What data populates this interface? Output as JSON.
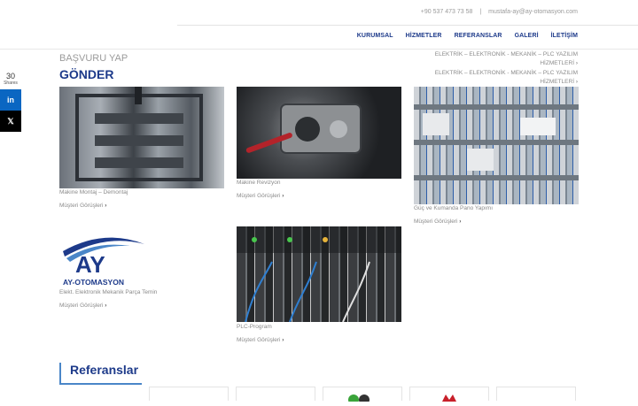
{
  "header": {
    "phone": "+90 537 473 73 58",
    "separator": "|",
    "email": "mustafa-ay@ay-otomasyon.com",
    "nav": [
      "KURUMSAL",
      "HİZMETLER",
      "REFERANSLAR",
      "GALERİ",
      "İLETİŞİM"
    ]
  },
  "share": {
    "count": "30",
    "label": "Shares",
    "linkedin_glyph": "in",
    "x_glyph": "𝕏"
  },
  "page": {
    "apply_text": "BAŞVURU YAP",
    "send_text": "GÖNDER"
  },
  "services": {
    "line1": "ELEKTRİK – ELEKTRONİK - MEKANİK – PLC YAZILIM",
    "line2": "HİZMETLERİ",
    "line3": "ELEKTRİK – ELEKTRONİK - MEKANİK – PLC YAZILIM",
    "line4": "HİZMETLERİ",
    "chevron": "›"
  },
  "gallery": {
    "more_label": "Müşteri Görüşleri",
    "chevron": "›",
    "items": [
      {
        "caption": "Makine Montaj – Demontaj",
        "icon": "machine-assembly-photo"
      },
      {
        "caption": "Makine Revizyon",
        "icon": "carburetor-repair-photo"
      },
      {
        "caption": "Güç ve Kumanda Pano Yapımı",
        "icon": "electrical-panel-photo"
      },
      {
        "caption": "Elekt. Elektronik Mekanik Parça Temin",
        "icon": "ay-otomasyon-logo"
      },
      {
        "caption": "PLC-Program",
        "icon": "plc-wiring-photo"
      }
    ]
  },
  "logo": {
    "brand": "AY-OTOMASYON",
    "monogram": "AY",
    "colors": {
      "blue": "#1d3a8a",
      "light_blue": "#4a86c8"
    }
  },
  "references": {
    "title": "Referanslar"
  },
  "colors": {
    "accent": "#1d3a8a",
    "linkedin": "#0a66c2",
    "x": "#000000"
  }
}
